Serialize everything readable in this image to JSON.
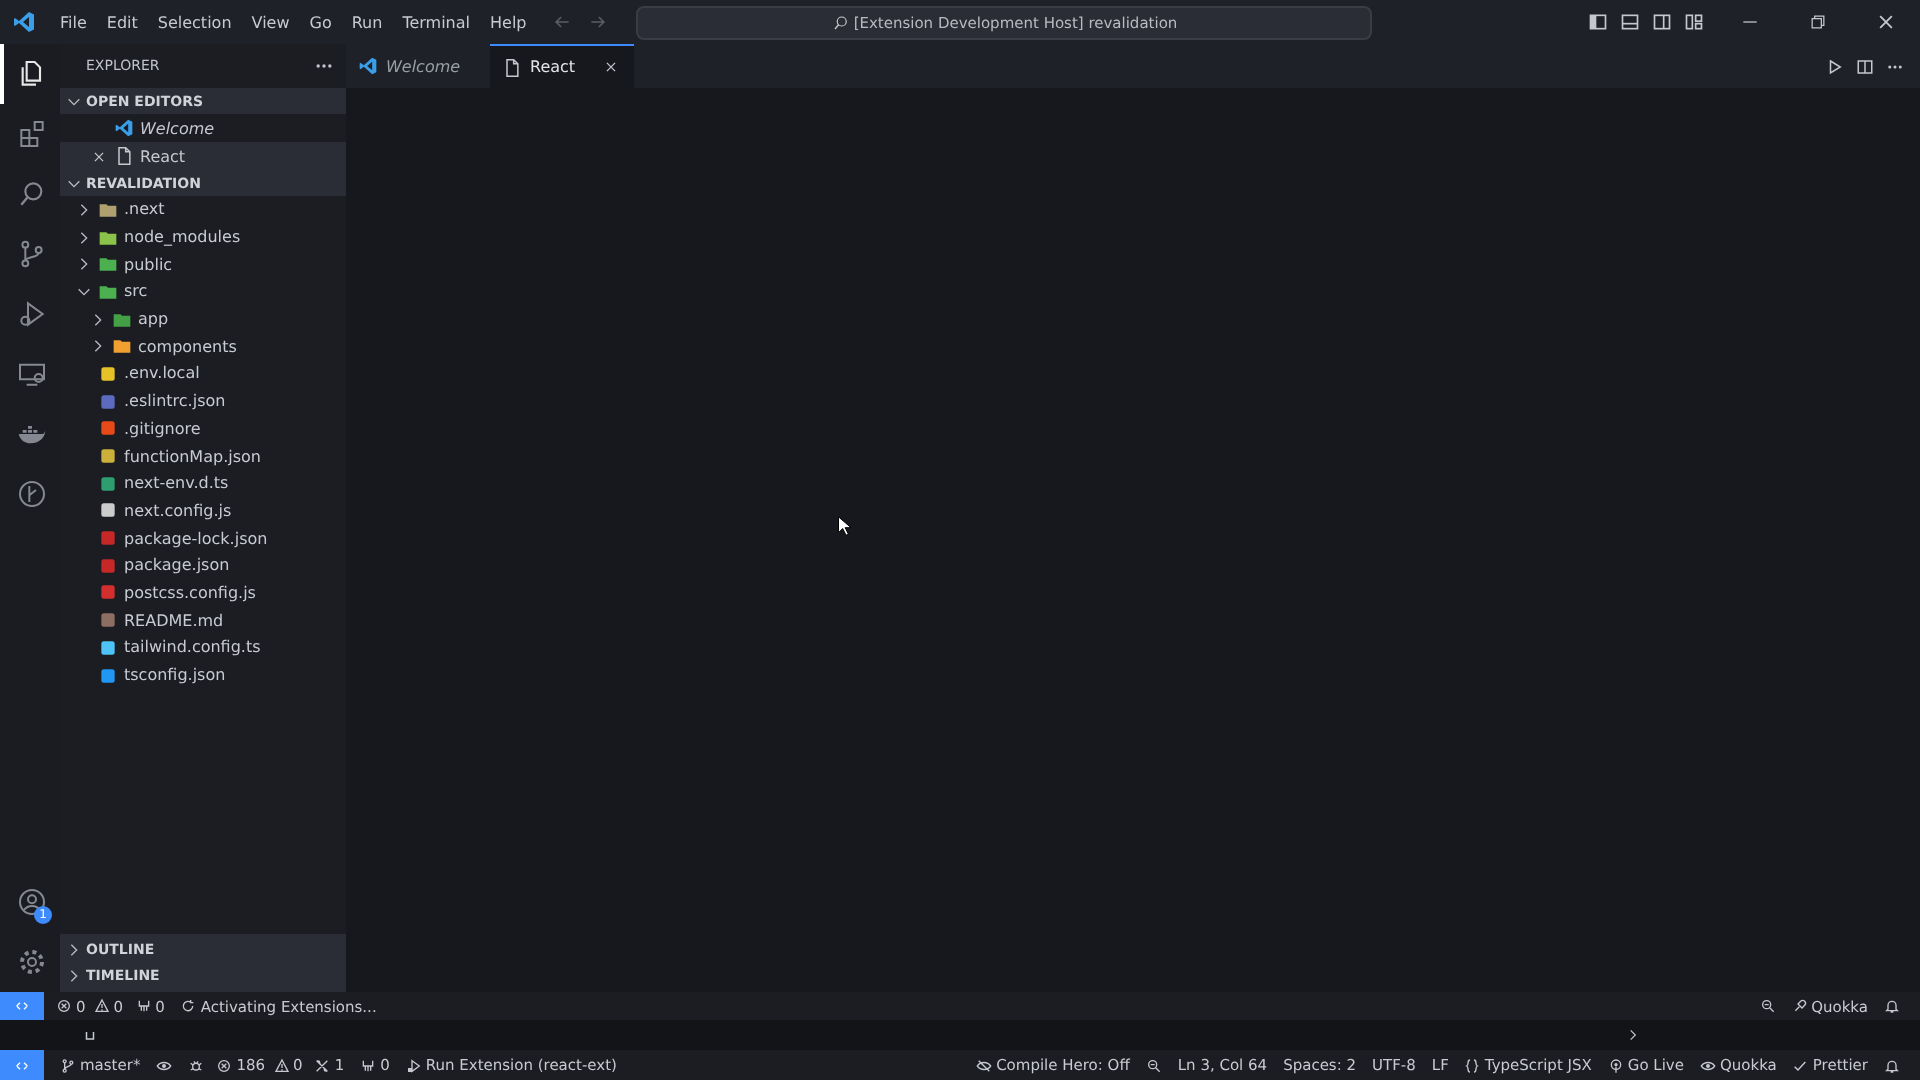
{
  "title_bar": {
    "menu": [
      "File",
      "Edit",
      "Selection",
      "View",
      "Go",
      "Run",
      "Terminal",
      "Help"
    ],
    "search": "[Extension Development Host] revalidation"
  },
  "activity_bar": {
    "items": [
      {
        "kind": "explorer",
        "selected": true
      },
      {
        "kind": "extensions",
        "selected": false
      },
      {
        "kind": "search",
        "selected": false
      },
      {
        "kind": "source-control",
        "selected": false
      },
      {
        "kind": "run-debug",
        "selected": false
      },
      {
        "kind": "remote",
        "selected": false
      },
      {
        "kind": "docker",
        "selected": false
      },
      {
        "kind": "git-graph",
        "selected": false
      }
    ],
    "account_badge": "1"
  },
  "sidebar": {
    "title": "EXPLORER",
    "open_editors": {
      "title": "OPEN EDITORS",
      "expanded": true,
      "items": [
        {
          "label": "Welcome",
          "kind": "vscode",
          "preview": true,
          "selected": false
        },
        {
          "label": "React",
          "kind": "file",
          "preview": false,
          "selected": true
        }
      ]
    },
    "folder": {
      "title": "REVALIDATION",
      "expanded": true,
      "items": [
        {
          "label": ".next",
          "kind": "folder",
          "expanded": false,
          "color": "#b0a070"
        },
        {
          "label": "node_modules",
          "kind": "folder",
          "expanded": false,
          "color": "#8bc34a"
        },
        {
          "label": "public",
          "kind": "folder",
          "expanded": false,
          "color": "#4caf50"
        },
        {
          "label": "src",
          "kind": "folder",
          "expanded": true,
          "color": "#4caf50",
          "children": [
            {
              "label": "app",
              "kind": "folder",
              "expanded": false,
              "color": "#43a047"
            },
            {
              "label": "components",
              "kind": "folder",
              "expanded": false,
              "color": "#f0a030"
            }
          ]
        },
        {
          "label": ".env.local",
          "kind": "file",
          "color": "#e6c229"
        },
        {
          "label": ".eslintrc.json",
          "kind": "file",
          "color": "#5c6bc0"
        },
        {
          "label": ".gitignore",
          "kind": "file",
          "color": "#e64a19"
        },
        {
          "label": "functionMap.json",
          "kind": "file",
          "color": "#cbb13b"
        },
        {
          "label": "next-env.d.ts",
          "kind": "file",
          "color": "#2e9e6e"
        },
        {
          "label": "next.config.js",
          "kind": "file",
          "color": "#cccccc"
        },
        {
          "label": "package-lock.json",
          "kind": "file",
          "color": "#c62828"
        },
        {
          "label": "package.json",
          "kind": "file",
          "color": "#c62828"
        },
        {
          "label": "postcss.config.js",
          "kind": "file",
          "color": "#d32f2f"
        },
        {
          "label": "README.md",
          "kind": "file",
          "color": "#8d6e63"
        },
        {
          "label": "tailwind.config.ts",
          "kind": "file",
          "color": "#4fc3f7"
        },
        {
          "label": "tsconfig.json",
          "kind": "file",
          "color": "#2196f3"
        }
      ]
    },
    "panels": [
      {
        "title": "OUTLINE",
        "expanded": false
      },
      {
        "title": "TIMELINE",
        "expanded": false
      }
    ]
  },
  "tabs": [
    {
      "label": "Welcome",
      "kind": "vscode",
      "preview": true,
      "selected": false
    },
    {
      "label": "React",
      "kind": "file",
      "preview": false,
      "selected": true
    }
  ],
  "status_bar_upper": {
    "left": [
      {
        "kind": "error",
        "text": "0"
      },
      {
        "kind": "warning",
        "text": "0"
      },
      {
        "kind": "ports",
        "text": "0"
      },
      {
        "kind": "sync",
        "text": "Activating Extensions..."
      }
    ],
    "right": [
      {
        "kind": "zoom"
      },
      {
        "kind": "quokka",
        "text": "Quokka"
      },
      {
        "kind": "bell"
      }
    ]
  },
  "status_bar": {
    "left": [
      {
        "kind": "branch",
        "text": "master*"
      },
      {
        "kind": "eye"
      },
      {
        "kind": "debug"
      },
      {
        "kind": "error",
        "text": "186"
      },
      {
        "kind": "warning",
        "text": "0"
      },
      {
        "kind": "tools",
        "text": "1"
      },
      {
        "kind": "ports",
        "text": "0"
      },
      {
        "kind": "run",
        "text": "Run Extension (react-ext)"
      }
    ],
    "right": [
      {
        "kind": "no-eye",
        "text": "Compile Hero: Off"
      },
      {
        "kind": "zoom"
      },
      {
        "kind": "plain",
        "text": "Ln 3, Col 64"
      },
      {
        "kind": "plain",
        "text": "Spaces: 2"
      },
      {
        "kind": "plain",
        "text": "UTF-8"
      },
      {
        "kind": "plain",
        "text": "LF"
      },
      {
        "kind": "braces",
        "text": "TypeScript JSX"
      },
      {
        "kind": "broadcast",
        "text": "Go Live"
      },
      {
        "kind": "eye",
        "text": "Quokka"
      },
      {
        "kind": "check",
        "text": "Prettier"
      },
      {
        "kind": "bell"
      }
    ]
  }
}
